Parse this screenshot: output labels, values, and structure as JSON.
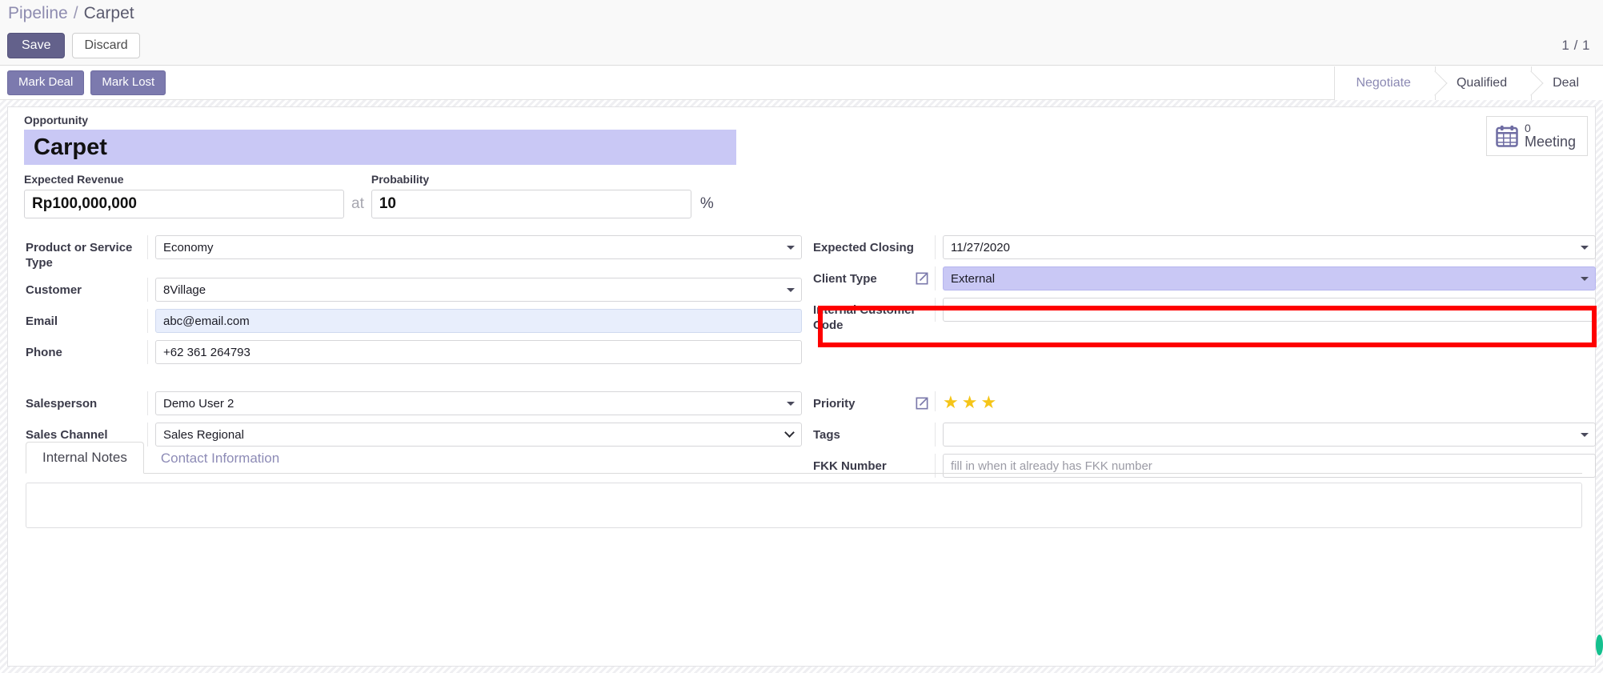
{
  "breadcrumb": {
    "root": "Pipeline",
    "separator": "/",
    "current": "Carpet"
  },
  "action_bar": {
    "save_label": "Save",
    "discard_label": "Discard",
    "pager": "1 / 1"
  },
  "status_bar": {
    "mark_deal_label": "Mark Deal",
    "mark_lost_label": "Mark Lost",
    "stages": [
      {
        "label": "Negotiate",
        "active": false
      },
      {
        "label": "Qualified",
        "active": true
      },
      {
        "label": "Deal",
        "active": true
      }
    ]
  },
  "stat_button": {
    "icon": "calendar-icon",
    "count": "0",
    "label": "Meeting"
  },
  "title": {
    "label": "Opportunity",
    "value": "Carpet"
  },
  "revenue": {
    "expected_revenue_label": "Expected Revenue",
    "expected_revenue_value": "Rp100,000,000",
    "at_text": "at",
    "probability_label": "Probability",
    "probability_value": "10",
    "percent_text": "%"
  },
  "fields": {
    "left_group_1": [
      {
        "label": "Product or Service Type",
        "value": "Economy",
        "type": "select",
        "name": "product-or-service-type"
      },
      {
        "label": "Customer",
        "value": "8Village",
        "type": "select",
        "name": "customer",
        "ext_link": true
      },
      {
        "label": "Email",
        "value": "abc@email.com",
        "type": "readonly",
        "name": "email"
      },
      {
        "label": "Phone",
        "value": "+62 361 264793",
        "type": "text",
        "name": "phone"
      }
    ],
    "right_group_1": [
      {
        "label": "Expected Closing",
        "value": "11/27/2020",
        "type": "select",
        "name": "expected-closing"
      },
      {
        "label": "Client Type",
        "value": "External",
        "type": "select",
        "name": "client-type",
        "highlighted": true
      },
      {
        "label": "Internal Customer Code",
        "value": "",
        "type": "text",
        "name": "internal-customer-code"
      }
    ],
    "left_group_2": [
      {
        "label": "Salesperson",
        "value": "Demo User 2",
        "type": "select",
        "name": "salesperson"
      },
      {
        "label": "Sales Channel",
        "value": "Sales Regional",
        "type": "select-thin",
        "name": "sales-channel"
      }
    ],
    "right_group_2": [
      {
        "label": "Priority",
        "value": "3",
        "type": "stars",
        "name": "priority",
        "ext_link": true
      },
      {
        "label": "Tags",
        "value": "",
        "type": "select",
        "name": "tags"
      },
      {
        "label": "FKK Number",
        "value": "",
        "placeholder": "fill in when it already has FKK number",
        "type": "text",
        "name": "fkk-number"
      }
    ]
  },
  "notebook": {
    "tabs": [
      {
        "label": "Internal Notes",
        "active": true
      },
      {
        "label": "Contact Information",
        "active": false
      }
    ],
    "notes_value": "",
    "notes_placeholder": ""
  },
  "colors": {
    "accent_purple": "#63618b",
    "stage_purple": "#7c7aae",
    "highlight_lavender": "#c9c8f5",
    "readonly_blue": "#e8eefc",
    "star_yellow": "#f5c518",
    "annotation_red": "#fe0000"
  }
}
